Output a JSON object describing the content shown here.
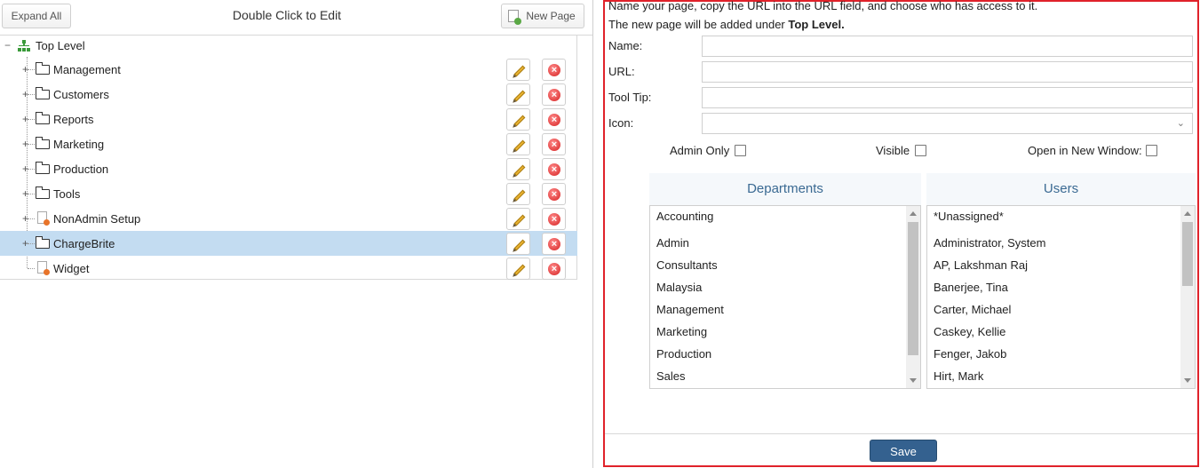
{
  "toolbar": {
    "expand_all_label": "Expand All",
    "title": "Double Click to Edit",
    "new_page_label": "New Page"
  },
  "tree": {
    "root_label": "Top Level",
    "items": [
      {
        "label": "Management",
        "type": "folder"
      },
      {
        "label": "Customers",
        "type": "folder"
      },
      {
        "label": "Reports",
        "type": "folder"
      },
      {
        "label": "Marketing",
        "type": "folder"
      },
      {
        "label": "Production",
        "type": "folder"
      },
      {
        "label": "Tools",
        "type": "folder"
      },
      {
        "label": "NonAdmin Setup",
        "type": "page"
      },
      {
        "label": "ChargeBrite",
        "type": "folder",
        "selected": true
      },
      {
        "label": "Widget",
        "type": "page"
      }
    ]
  },
  "form": {
    "help_line1": "Name your page, copy the URL into the URL field, and choose who has access to it.",
    "help_line2_prefix": "The new page will be added under ",
    "help_line2_bold": "Top Level.",
    "name_label": "Name:",
    "name_value": "",
    "url_label": "URL:",
    "url_value": "",
    "tooltip_label": "Tool Tip:",
    "tooltip_value": "",
    "icon_label": "Icon:",
    "icon_value": "",
    "admin_only_label": "Admin Only",
    "admin_only_checked": false,
    "visible_label": "Visible",
    "visible_checked": false,
    "new_window_label": "Open in New Window:",
    "new_window_checked": false
  },
  "departments": {
    "header": "Departments",
    "items": [
      "Accounting",
      "Admin",
      "Consultants",
      "Malaysia",
      "Management",
      "Marketing",
      "Production",
      "Sales"
    ]
  },
  "users": {
    "header": "Users",
    "items": [
      "*Unassigned*",
      "Administrator, System",
      "AP, Lakshman Raj",
      "Banerjee, Tina",
      "Carter, Michael",
      "Caskey, Kellie",
      "Fenger, Jakob",
      "Hirt, Mark"
    ]
  },
  "save_label": "Save",
  "colors": {
    "accent": "#34618f",
    "selection": "#c3dcf1",
    "frame_border": "#e0222a",
    "list_header_text": "#3b6a93"
  }
}
